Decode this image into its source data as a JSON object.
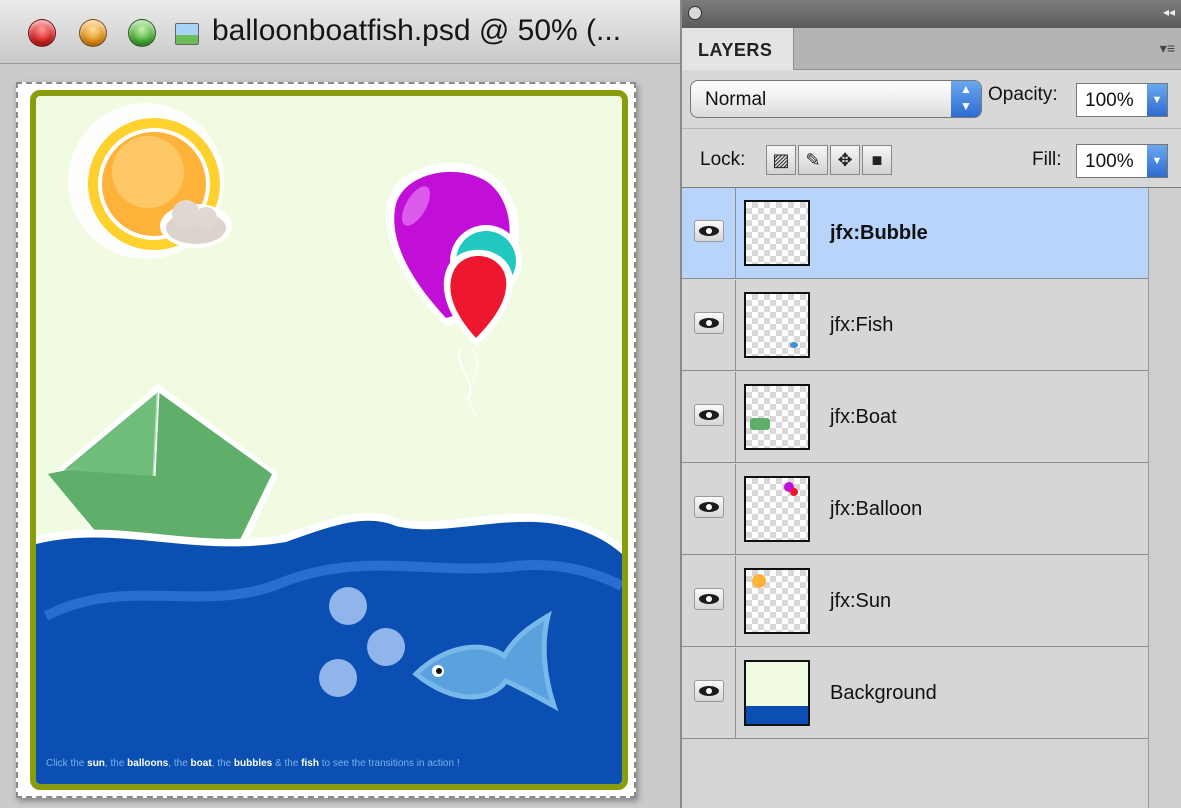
{
  "window": {
    "title": "balloonboatfish.psd @ 50% (...",
    "file_icon": "image-file-icon"
  },
  "artwork": {
    "footer": {
      "w1": "Click the",
      "k1": "sun",
      "w2": ", the",
      "k2": "balloons",
      "w3": ", the",
      "k3": "boat",
      "w4": ", the",
      "k4": "bubbles",
      "w5": "& the",
      "k5": "fish",
      "w6": "to see the transitions in action !"
    }
  },
  "panel": {
    "tab_label": "LAYERS",
    "menu_icon": "panel-menu-icon",
    "blend_mode": "Normal",
    "opacity_label": "Opacity:",
    "opacity_value": "100%",
    "lock_label": "Lock:",
    "lock_icons": [
      "lock-transparent-pixels-icon",
      "lock-image-pixels-icon",
      "lock-position-icon",
      "lock-all-icon"
    ],
    "fill_label": "Fill:",
    "fill_value": "100%"
  },
  "layers": [
    {
      "name": "jfx:Bubble",
      "selected": true,
      "visible": true
    },
    {
      "name": "jfx:Fish",
      "selected": false,
      "visible": true
    },
    {
      "name": "jfx:Boat",
      "selected": false,
      "visible": true
    },
    {
      "name": "jfx:Balloon",
      "selected": false,
      "visible": true
    },
    {
      "name": "jfx:Sun",
      "selected": false,
      "visible": true
    },
    {
      "name": "Background",
      "selected": false,
      "visible": true
    }
  ],
  "colors": {
    "selection": "#b8d4fb",
    "sea": "#0b4fb3",
    "artwork_bg": "#f0fbe2",
    "frame": "#8a9c0c",
    "boat": "#5fae6a",
    "balloon_purple": "#c20fd8",
    "balloon_red": "#ee1730",
    "fish": "#3f8fd1",
    "sun": "#ffb23a"
  }
}
